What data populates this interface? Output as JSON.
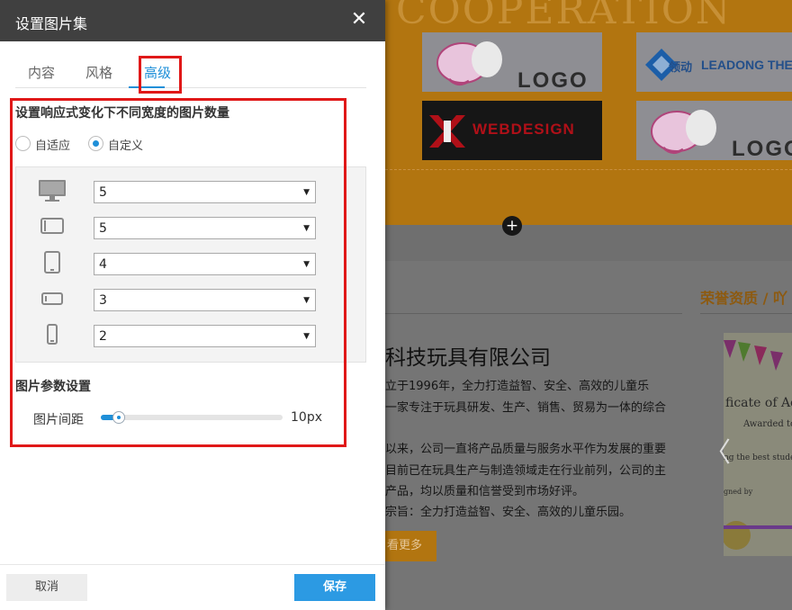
{
  "dialog": {
    "title": "设置图片集",
    "close_glyph": "✕"
  },
  "tabs": [
    {
      "label": "内容",
      "active": false
    },
    {
      "label": "风格",
      "active": false
    },
    {
      "label": "高级",
      "active": true
    }
  ],
  "responsive": {
    "title": "设置响应式变化下不同宽度的图片数量",
    "radio_auto": "自适应",
    "radio_custom": "自定义",
    "selected_mode": "custom",
    "devices": [
      {
        "icon": "desktop-monitor-icon",
        "value": "5"
      },
      {
        "icon": "laptop-icon",
        "value": "5"
      },
      {
        "icon": "tablet-portrait-icon",
        "value": "4"
      },
      {
        "icon": "tablet-landscape-icon",
        "value": "3"
      },
      {
        "icon": "phone-icon",
        "value": "2"
      }
    ],
    "caret_glyph": "▼"
  },
  "image_params": {
    "title": "图片参数设置",
    "spacing_label": "图片间距",
    "spacing_value": "10px",
    "spacing_fraction": 0.1
  },
  "footer": {
    "cancel_label": "取消",
    "save_label": "保存"
  },
  "background": {
    "watermark": "COOPERATION",
    "logo_text": "LOGO",
    "leadong_text": "LEADONG THE",
    "leadong_cn": "领动",
    "webdesign_text": "WEBDESIGN",
    "plus_glyph": "+",
    "honor_title": "荣誉资质 / 吖",
    "company_title": "科技玩具有限公司",
    "para_lines": [
      "立于1996年，全力打造益智、安全、高效的儿童乐",
      "一家专注于玩具研发、生产、销售、贸易为一体的综合",
      "以来，公司一直将产品质量与服务水平作为发展的重要",
      "目前已在玩具生产与制造领域走在行业前列，公司的主",
      "产品，均以质量和信誉受到市场好评。",
      "宗旨：全力打造益智、安全、高效的儿童乐园。"
    ],
    "more_label": "看更多",
    "cert_line1": "ficate of Ach",
    "cert_line2": "Awarded to",
    "cert_line3": "ng the best student",
    "cert_line4": "gned by",
    "arrow_glyph": "〈"
  },
  "colors": {
    "accent_blue": "#1f8fd8",
    "save_blue": "#2c9ae3",
    "highlight_red": "#e01818",
    "header_dark": "#404040",
    "bg_orange": "#b27510"
  }
}
